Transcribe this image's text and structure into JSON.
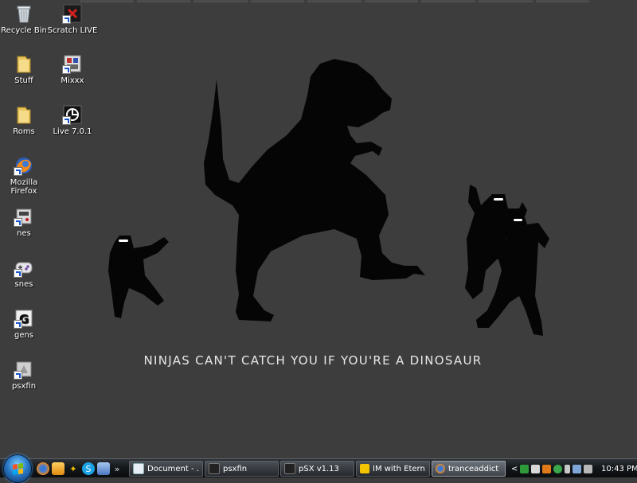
{
  "desktop": {
    "icons": [
      {
        "label": "Recycle Bin",
        "icon": "recycle-bin-icon"
      },
      {
        "label": "Scratch LIVE",
        "icon": "scratch-live-icon"
      },
      {
        "label": "Stuff",
        "icon": "folder-icon"
      },
      {
        "label": "Mixxx",
        "icon": "mixxx-icon"
      },
      {
        "label": "Roms",
        "icon": "folder-icon"
      },
      {
        "label": "Live 7.0.1",
        "icon": "ableton-live-icon"
      },
      {
        "label": "Mozilla Firefox",
        "icon": "firefox-icon"
      },
      {
        "label": "nes",
        "icon": "nes-emulator-icon"
      },
      {
        "label": "snes",
        "icon": "snes-emulator-icon"
      },
      {
        "label": "gens",
        "icon": "gens-emulator-icon"
      },
      {
        "label": "psxfin",
        "icon": "psxfin-icon"
      }
    ],
    "wallpaper_caption": "NINJAS CAN'T CATCH YOU IF YOU'RE A DINOSAUR"
  },
  "taskbar": {
    "quick_launch": [
      {
        "icon": "firefox-icon"
      },
      {
        "icon": "switch-windows-icon"
      },
      {
        "icon": "aim-running-man-icon"
      },
      {
        "icon": "skype-icon"
      },
      {
        "icon": "show-desktop-icon"
      }
    ],
    "more_label": "»",
    "buttons": [
      {
        "label": "Document - ...",
        "icon": "document-icon",
        "active": false
      },
      {
        "label": "psxfin",
        "icon": "psxfin-icon",
        "active": false
      },
      {
        "label": "pSX v1.13",
        "icon": "psx-icon",
        "active": false
      },
      {
        "label": "IM with Etern...",
        "icon": "aim-running-man-icon",
        "active": false
      },
      {
        "label": "tranceaddict ...",
        "icon": "firefox-icon",
        "active": true
      }
    ],
    "tray": {
      "expand_label": "<",
      "icons": [
        "network-icon",
        "antivirus-icon",
        "update-icon",
        "sync-icon",
        "device-icon",
        "network-icon",
        "volume-icon"
      ],
      "clock": "10:43 PM"
    }
  },
  "colors": {
    "desktop_bg": "#3d3d3d",
    "silhouette": "#050505",
    "caption": "#e8e8e8"
  }
}
